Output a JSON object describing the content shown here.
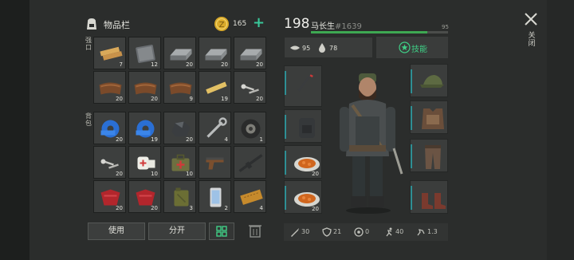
{
  "inventory": {
    "title": "物品栏",
    "coins": "165",
    "add_label": "+",
    "section_labels": [
      "强口",
      "背包"
    ],
    "slots": [
      {
        "item": "wood-planks",
        "qty": "7"
      },
      {
        "item": "metal-plate",
        "qty": "12"
      },
      {
        "item": "iron-ingot",
        "qty": "20"
      },
      {
        "item": "iron-ingot",
        "qty": "20"
      },
      {
        "item": "iron-ingot",
        "qty": "20"
      },
      {
        "item": "leather",
        "qty": "20"
      },
      {
        "item": "leather",
        "qty": "20"
      },
      {
        "item": "leather",
        "qty": "9"
      },
      {
        "item": "wood-plank",
        "qty": "19"
      },
      {
        "item": "nails",
        "qty": "20"
      },
      {
        "item": "blue-tape",
        "qty": "20"
      },
      {
        "item": "blue-tape",
        "qty": "19"
      },
      {
        "item": "coal",
        "qty": "20"
      },
      {
        "item": "wrench",
        "qty": "4"
      },
      {
        "item": "tire",
        "qty": "1"
      },
      {
        "item": "nails",
        "qty": "20"
      },
      {
        "item": "bandage",
        "qty": "10"
      },
      {
        "item": "medkit-bag",
        "qty": "10"
      },
      {
        "item": "pistol",
        "qty": ""
      },
      {
        "item": "rifle",
        "qty": ""
      },
      {
        "item": "red-fabric",
        "qty": "20"
      },
      {
        "item": "red-fabric",
        "qty": "20"
      },
      {
        "item": "gas-can",
        "qty": "3"
      },
      {
        "item": "phone",
        "qty": "2"
      },
      {
        "item": "ticket",
        "qty": "4"
      }
    ],
    "buttons": {
      "use": "使用",
      "split": "分开"
    }
  },
  "character": {
    "level": "198",
    "name": "马长生",
    "id": "#1639",
    "xp_value": "95",
    "xp_fraction": 0.85,
    "food": "95",
    "water": "78",
    "skills_label": "技能",
    "weapon_slots": [
      {
        "item": "crowbar",
        "qty": ""
      },
      {
        "item": "backpack",
        "qty": ""
      },
      {
        "item": "food-plate",
        "qty": "20"
      },
      {
        "item": "food-plate",
        "qty": "20"
      }
    ],
    "armor_slots": [
      "cap",
      "body-armor",
      "pants",
      "boots"
    ],
    "stats": [
      "30",
      "21",
      "0",
      "40",
      "1.3"
    ]
  },
  "close_label": "关闭",
  "colors": {
    "accent_green": "#3fcf86",
    "xp_green": "#3ea852",
    "coin_gold": "#d8a92a",
    "teal_accent": "#2e8f94"
  }
}
